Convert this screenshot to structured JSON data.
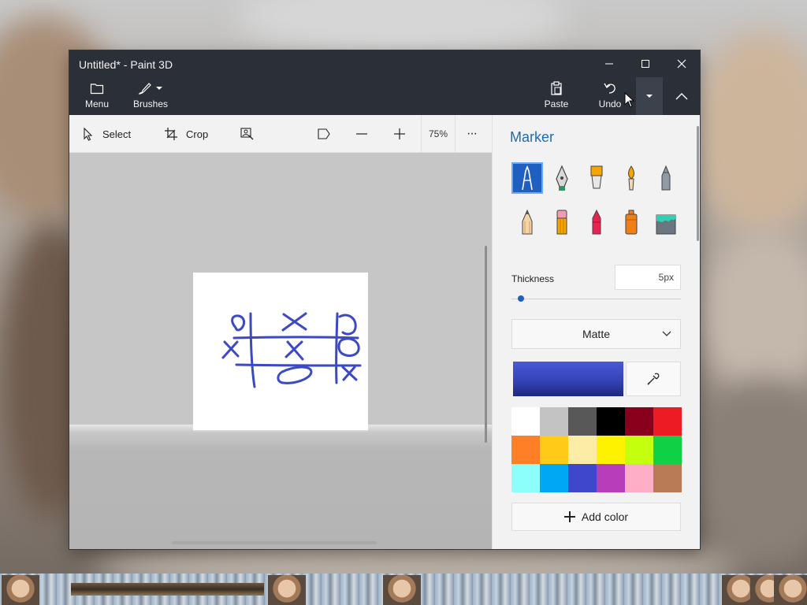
{
  "window": {
    "title": "Untitled* - Paint 3D"
  },
  "toolbar": {
    "menu_label": "Menu",
    "brushes_label": "Brushes",
    "paste_label": "Paste",
    "undo_label": "Undo"
  },
  "commands": {
    "select_label": "Select",
    "crop_label": "Crop",
    "zoom_value": "75%",
    "more_glyph": "···"
  },
  "panel": {
    "title": "Marker",
    "thickness_label": "Thickness",
    "thickness_value": "5px",
    "thickness_fraction": 0.05,
    "finish_value": "Matte",
    "add_color_label": "Add color",
    "brushes": [
      {
        "name": "marker-icon",
        "selected": true
      },
      {
        "name": "calligraphy-pen-icon"
      },
      {
        "name": "oil-brush-icon"
      },
      {
        "name": "watercolor-icon"
      },
      {
        "name": "pixel-pen-icon"
      },
      {
        "name": "pencil-icon"
      },
      {
        "name": "eraser-icon"
      },
      {
        "name": "crayon-icon"
      },
      {
        "name": "spray-can-icon"
      },
      {
        "name": "fill-bucket-icon"
      }
    ],
    "current_color": "#3c49c4",
    "palette": [
      "#ffffff",
      "#c3c3c3",
      "#585858",
      "#000000",
      "#88001b",
      "#ec1c24",
      "#ff7f27",
      "#ffca18",
      "#fdeca6",
      "#fff200",
      "#c4ff0e",
      "#0ed145",
      "#8cfffb",
      "#00a8f3",
      "#3f48cc",
      "#b83dba",
      "#ffaec8",
      "#b97a56"
    ]
  }
}
